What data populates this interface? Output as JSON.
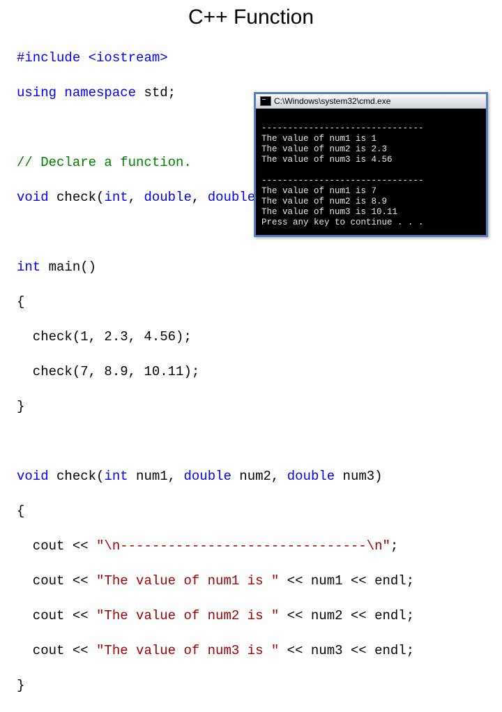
{
  "title": "C++ Function",
  "code": {
    "l1": {
      "a": "#include",
      "b": " ",
      "c": "<iostream>"
    },
    "l2": {
      "a": "using",
      "b": " ",
      "c": "namespace",
      "d": " std;"
    },
    "l3": "// Declare a function.",
    "l4": {
      "a": "void",
      "b": " check(",
      "c": "int",
      "d": ", ",
      "e": "double",
      "f": ", ",
      "g": "double",
      "h": ");"
    },
    "l5": {
      "a": "int",
      "b": " main()"
    },
    "l6": "{",
    "l7": "  check(1, 2.3, 4.56);",
    "l8": "  check(7, 8.9, 10.11);",
    "l9": "}",
    "l10": {
      "a": "void",
      "b": " check(",
      "c": "int",
      "d": " num1, ",
      "e": "double",
      "f": " num2, ",
      "g": "double",
      "h": " num3)"
    },
    "l11": "{",
    "l12": {
      "a": "  cout << ",
      "b": "\"\\n-------------------------------\\n\"",
      "c": ";"
    },
    "l13": {
      "a": "  cout << ",
      "b": "\"The value of num1 is \"",
      "c": " << num1 << endl;"
    },
    "l14": {
      "a": "  cout << ",
      "b": "\"The value of num2 is \"",
      "c": " << num2 << endl;"
    },
    "l15": {
      "a": "  cout << ",
      "b": "\"The value of num3 is \"",
      "c": " << num3 << endl;"
    },
    "l16": "}"
  },
  "console": {
    "title": "C:\\Windows\\system32\\cmd.exe",
    "output": "\n-------------------------------\nThe value of num1 is 1\nThe value of num2 is 2.3\nThe value of num3 is 4.56\n\n-------------------------------\nThe value of num1 is 7\nThe value of num2 is 8.9\nThe value of num3 is 10.11\nPress any key to continue . . ."
  }
}
